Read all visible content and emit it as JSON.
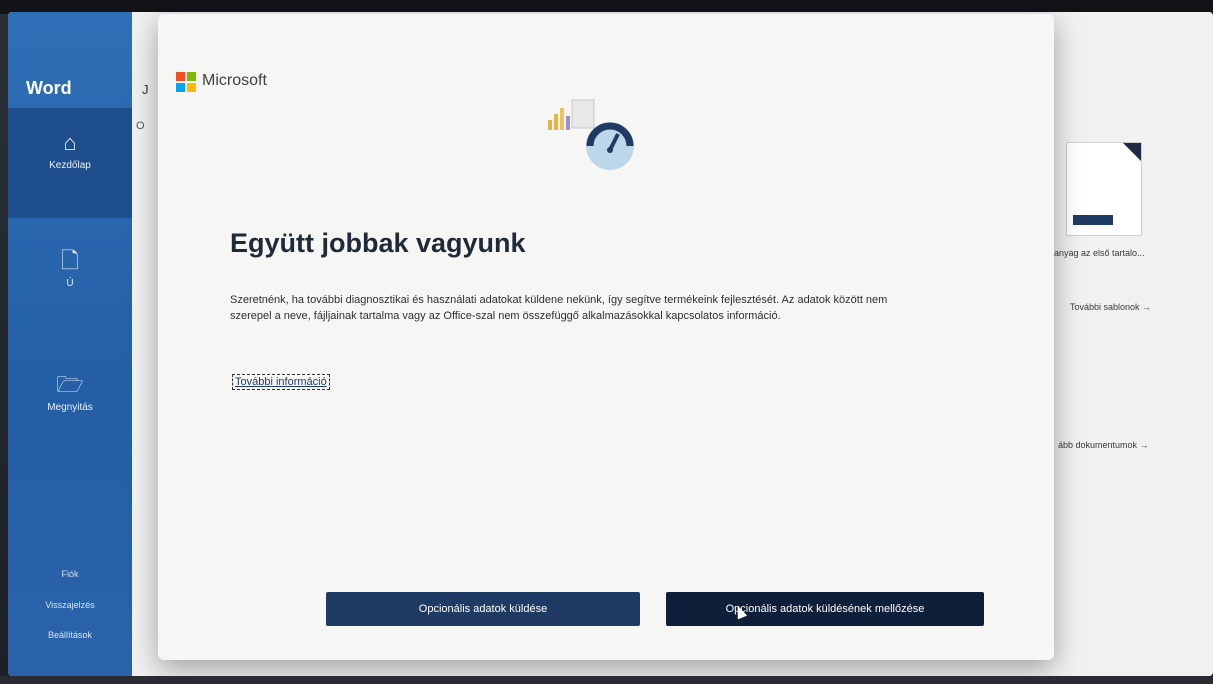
{
  "app": {
    "name": "Word",
    "background_header_fragment": "J",
    "background_fragment_2": "O"
  },
  "sidebar": {
    "items": [
      {
        "label": "Kezdőlap",
        "icon": "home-icon"
      },
      {
        "label": "Ú",
        "icon": "new-document-icon"
      },
      {
        "label": "Megnyitás",
        "icon": "folder-open-icon"
      }
    ],
    "bottom_items": [
      {
        "label": "Fiók"
      },
      {
        "label": "Visszajelzés"
      },
      {
        "label": "Beállítások"
      }
    ]
  },
  "background_right": {
    "card_title": "anyag az első tartalo...",
    "more_templates": "További sablonok →",
    "more_documents": "ább dokumentumok →"
  },
  "dialog": {
    "brand": "Microsoft",
    "headline": "Együtt jobbak vagyunk",
    "body": "Szeretnénk, ha további diagnosztikai és használati adatokat küldene nekünk, így segítve termékeink fejlesztését. Az adatok között nem szerepel a neve, fájljainak tartalma vagy az Office-szal nem összefüggő alkalmazásokkal kapcsolatos információ.",
    "more_info_link": "További információ",
    "button_send": "Opcionális adatok küldése",
    "button_skip": "Opcionális adatok küldésének mellőzése"
  },
  "colors": {
    "sidebar_blue": "#2f6fb6",
    "button_navy": "#1f3b63",
    "button_dark_navy": "#0f1f3a",
    "logo_red": "#f25022",
    "logo_green": "#7fba00",
    "logo_blue": "#00a4ef",
    "logo_yellow": "#ffb900"
  }
}
